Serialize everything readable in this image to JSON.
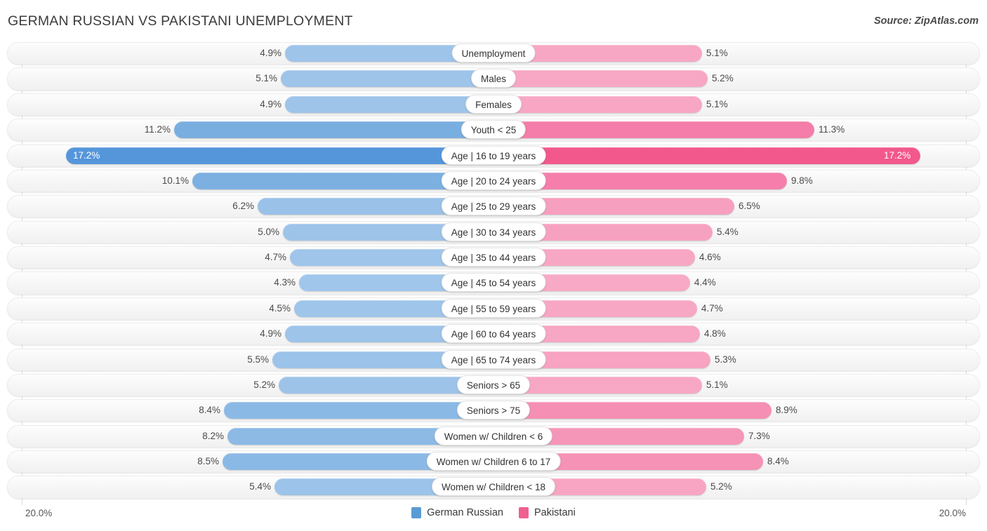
{
  "header": {
    "title": "GERMAN RUSSIAN VS PAKISTANI UNEMPLOYMENT",
    "source": "Source: ZipAtlas.com"
  },
  "axis": {
    "min_label": "20.0%",
    "max_label": "20.0%"
  },
  "legend": {
    "items": [
      {
        "label": "German Russian",
        "color": "#5b9bd5"
      },
      {
        "label": "Pakistani",
        "color": "#f0608f"
      }
    ]
  },
  "chart_data": {
    "type": "bar",
    "title": "GERMAN RUSSIAN VS PAKISTANI UNEMPLOYMENT",
    "subtitle": "Source: ZipAtlas.com",
    "orientation": "horizontal-diverging",
    "xlabel": "",
    "ylabel": "",
    "xlim": [
      -20.0,
      20.0
    ],
    "axis_tick_labels": [
      "20.0%",
      "20.0%"
    ],
    "grid": true,
    "legend_position": "bottom-center",
    "categories": [
      "Unemployment",
      "Males",
      "Females",
      "Youth < 25",
      "Age | 16 to 19 years",
      "Age | 20 to 24 years",
      "Age | 25 to 29 years",
      "Age | 30 to 34 years",
      "Age | 35 to 44 years",
      "Age | 45 to 54 years",
      "Age | 55 to 59 years",
      "Age | 60 to 64 years",
      "Age | 65 to 74 years",
      "Seniors > 65",
      "Seniors > 75",
      "Women w/ Children < 6",
      "Women w/ Children 6 to 17",
      "Women w/ Children < 18"
    ],
    "series": [
      {
        "name": "German Russian",
        "color": "#5b9bd5",
        "values": [
          4.9,
          5.1,
          4.9,
          11.2,
          17.2,
          10.1,
          6.2,
          5.0,
          4.7,
          4.3,
          4.5,
          4.9,
          5.5,
          5.2,
          8.4,
          8.2,
          8.5,
          5.4
        ]
      },
      {
        "name": "Pakistani",
        "color": "#f0608f",
        "values": [
          5.1,
          5.2,
          5.1,
          11.3,
          17.2,
          9.8,
          6.5,
          5.4,
          4.6,
          4.4,
          4.7,
          4.8,
          5.3,
          5.1,
          8.9,
          7.3,
          8.4,
          5.2
        ]
      }
    ]
  },
  "rows": [
    {
      "label": "Unemployment",
      "left_value": "4.9%",
      "right_value": "5.1%",
      "left_w": 297,
      "right_w": 297,
      "left_color": "#9ec4ea",
      "right_color": "#f7a7c4",
      "left_inside": false,
      "right_inside": false
    },
    {
      "label": "Males",
      "left_value": "5.1%",
      "right_value": "5.2%",
      "left_w": 303,
      "right_w": 305,
      "left_color": "#9ec4ea",
      "right_color": "#f7a7c4",
      "left_inside": false,
      "right_inside": false
    },
    {
      "label": "Females",
      "left_value": "4.9%",
      "right_value": "5.1%",
      "left_w": 297,
      "right_w": 297,
      "left_color": "#9ec4ea",
      "right_color": "#f7a7c4",
      "left_inside": false,
      "right_inside": false
    },
    {
      "label": "Youth < 25",
      "left_value": "11.2%",
      "right_value": "11.3%",
      "left_w": 455,
      "right_w": 457,
      "left_color": "#79aee0",
      "right_color": "#f47da9",
      "left_inside": false,
      "right_inside": false
    },
    {
      "label": "Age | 16 to 19 years",
      "left_value": "17.2%",
      "right_value": "17.2%",
      "left_w": 609,
      "right_w": 608,
      "left_color": "#5596db",
      "right_color": "#f2588c",
      "left_inside": true,
      "right_inside": true
    },
    {
      "label": "Age | 20 to 24 years",
      "left_value": "10.1%",
      "right_value": "9.8%",
      "left_w": 429,
      "right_w": 418,
      "left_color": "#7cb0e1",
      "right_color": "#f57eaa",
      "left_inside": false,
      "right_inside": false
    },
    {
      "label": "Age | 25 to 29 years",
      "left_value": "6.2%",
      "right_value": "6.5%",
      "left_w": 336,
      "right_w": 343,
      "left_color": "#9ac1e8",
      "right_color": "#f69fbf",
      "left_inside": false,
      "right_inside": false
    },
    {
      "label": "Age | 30 to 34 years",
      "left_value": "5.0%",
      "right_value": "5.4%",
      "left_w": 300,
      "right_w": 312,
      "left_color": "#9ec4ea",
      "right_color": "#f7a1c0",
      "left_inside": false,
      "right_inside": false
    },
    {
      "label": "Age | 35 to 44 years",
      "left_value": "4.7%",
      "right_value": "4.6%",
      "left_w": 290,
      "right_w": 287,
      "left_color": "#9fc5ea",
      "right_color": "#f7a7c4",
      "left_inside": false,
      "right_inside": false
    },
    {
      "label": "Age | 45 to 54 years",
      "left_value": "4.3%",
      "right_value": "4.4%",
      "left_w": 277,
      "right_w": 280,
      "left_color": "#a0c6eb",
      "right_color": "#f7a9c5",
      "left_inside": false,
      "right_inside": false
    },
    {
      "label": "Age | 55 to 59 years",
      "left_value": "4.5%",
      "right_value": "4.7%",
      "left_w": 284,
      "right_w": 290,
      "left_color": "#9fc5ea",
      "right_color": "#f7a7c4",
      "left_inside": false,
      "right_inside": false
    },
    {
      "label": "Age | 60 to 64 years",
      "left_value": "4.9%",
      "right_value": "4.8%",
      "left_w": 297,
      "right_w": 294,
      "left_color": "#9ec4ea",
      "right_color": "#f7a6c3",
      "left_inside": false,
      "right_inside": false
    },
    {
      "label": "Age | 65 to 74 years",
      "left_value": "5.5%",
      "right_value": "5.3%",
      "left_w": 315,
      "right_w": 309,
      "left_color": "#9cc3e9",
      "right_color": "#f7a3c1",
      "left_inside": false,
      "right_inside": false
    },
    {
      "label": "Seniors > 65",
      "left_value": "5.2%",
      "right_value": "5.1%",
      "left_w": 306,
      "right_w": 297,
      "left_color": "#9dc3e9",
      "right_color": "#f7a7c4",
      "left_inside": false,
      "right_inside": false
    },
    {
      "label": "Seniors > 75",
      "left_value": "8.4%",
      "right_value": "8.9%",
      "left_w": 384,
      "right_w": 396,
      "left_color": "#8bb9e5",
      "right_color": "#f58fb4",
      "left_inside": false,
      "right_inside": false
    },
    {
      "label": "Women w/ Children < 6",
      "left_value": "8.2%",
      "right_value": "7.3%",
      "left_w": 379,
      "right_w": 357,
      "left_color": "#8cbae5",
      "right_color": "#f596b9",
      "left_inside": false,
      "right_inside": false
    },
    {
      "label": "Women w/ Children 6 to 17",
      "left_value": "8.5%",
      "right_value": "8.4%",
      "left_w": 386,
      "right_w": 384,
      "left_color": "#8bb9e5",
      "right_color": "#f592b6",
      "left_inside": false,
      "right_inside": false
    },
    {
      "label": "Women w/ Children < 18",
      "left_value": "5.4%",
      "right_value": "5.2%",
      "left_w": 312,
      "right_w": 303,
      "left_color": "#9cc3e9",
      "right_color": "#f7a5c3",
      "left_inside": false,
      "right_inside": false
    }
  ]
}
